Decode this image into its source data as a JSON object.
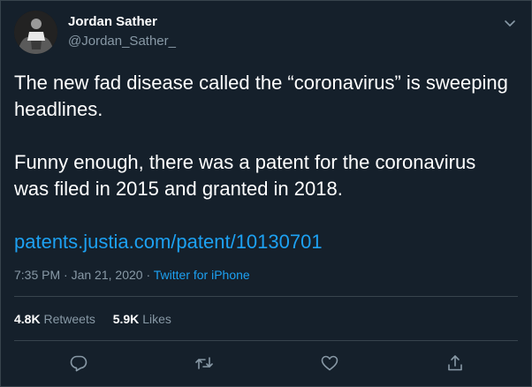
{
  "tweet": {
    "author_name": "Jordan Sather",
    "author_handle": "@Jordan_Sather_",
    "paragraph_1": "The new fad disease called the “coronavirus” is sweeping headlines.",
    "paragraph_2": "Funny enough, there was a patent for the coronavirus was filed in 2015 and granted in 2018.",
    "link_text": "patents.justia.com/patent/10130701",
    "time": "7:35 PM",
    "date": "Jan 21, 2020",
    "separator": "·",
    "source": "Twitter for iPhone"
  },
  "stats": {
    "retweets_count": "4.8K",
    "retweets_label": "Retweets",
    "likes_count": "5.9K",
    "likes_label": "Likes"
  },
  "icons": {
    "caret": "chevron-down-icon",
    "reply": "reply-icon",
    "retweet": "retweet-icon",
    "like": "heart-icon",
    "share": "share-icon"
  },
  "colors": {
    "background": "#15202b",
    "border": "#38444d",
    "text_primary": "#ffffff",
    "text_secondary": "#8899a6",
    "accent": "#1da1f2"
  }
}
